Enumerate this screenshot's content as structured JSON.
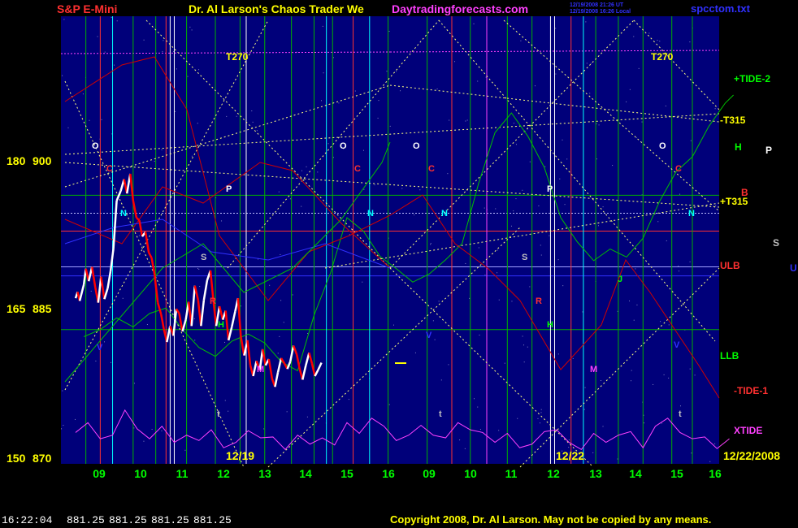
{
  "header": {
    "symbol": "S&P E-Mini",
    "title": "Dr. Al Larson's Chaos Trader We",
    "site": "Daytradingforecasts.com",
    "stamp1": "12/19/2008 21:26 UT",
    "stamp2": "12/19/2008 16:26 Local",
    "file": "spcctom.txt"
  },
  "footer": {
    "time": "16:22:04",
    "ohlc": [
      "881.25",
      "881.25",
      "881.25",
      "881.25"
    ],
    "copyright": "Copyright 2008, Dr. Al Larson. May not be copied by any means."
  },
  "colors": {
    "background": "#00007a",
    "price_up": "#ffffff",
    "price_down": "#ff0000",
    "tide": "#00c000",
    "xtide": "#ff40ff",
    "red_line": "#d00000",
    "blue_line": "#3030ff",
    "grid": "#00b000",
    "dotted": "#ffff80"
  },
  "chart_data": {
    "type": "line",
    "title": "S&P E-Mini",
    "left_axis_labels": [
      {
        "angle": "180",
        "price": "900"
      },
      {
        "angle": "165",
        "price": "885"
      },
      {
        "angle": "150",
        "price": "870"
      }
    ],
    "ylim": [
      870,
      920
    ],
    "x_ticks": [
      "09",
      "10",
      "11",
      "12",
      "13",
      "14",
      "15",
      "16",
      "09",
      "10",
      "11",
      "12",
      "13",
      "14",
      "15",
      "16"
    ],
    "date_labels": [
      "12/19",
      "12/22",
      "12/22/2008"
    ],
    "right_labels": [
      {
        "text": "+TIDE-2",
        "color": "#00ff00"
      },
      {
        "text": "-T315",
        "color": "#ffff00"
      },
      {
        "text": "H",
        "color": "#00ff00"
      },
      {
        "text": "P",
        "color": "#ffffff"
      },
      {
        "text": "B",
        "color": "#ff3030"
      },
      {
        "text": "+T315",
        "color": "#ffff00"
      },
      {
        "text": "S",
        "color": "#c0c0c0"
      },
      {
        "text": "U",
        "color": "#3030ff"
      },
      {
        "text": "ULB",
        "color": "#ff3030"
      },
      {
        "text": "LLB",
        "color": "#00ff00"
      },
      {
        "text": "-TIDE-1",
        "color": "#ff3030"
      },
      {
        "text": "XTIDE",
        "color": "#ff40ff"
      }
    ],
    "t270_labels": [
      "T270",
      "T270"
    ],
    "planet_letters": [
      {
        "text": "O",
        "color": "#ffffff"
      },
      {
        "text": "C",
        "color": "#ff3030"
      },
      {
        "text": "N",
        "color": "#00ffff"
      },
      {
        "text": "P",
        "color": "#ffffff"
      },
      {
        "text": "S",
        "color": "#c0c0c0"
      },
      {
        "text": "R",
        "color": "#ff3030"
      },
      {
        "text": "H",
        "color": "#00ff00"
      },
      {
        "text": "V",
        "color": "#3030ff"
      },
      {
        "text": "M",
        "color": "#ff40ff"
      },
      {
        "text": "t",
        "color": "#c0c0c0"
      },
      {
        "text": "O",
        "color": "#ffffff"
      },
      {
        "text": "C",
        "color": "#ff3030"
      },
      {
        "text": "N",
        "color": "#00ffff"
      },
      {
        "text": "O",
        "color": "#ffffff"
      },
      {
        "text": "C",
        "color": "#ff3030"
      },
      {
        "text": "N",
        "color": "#00ffff"
      },
      {
        "text": "V",
        "color": "#3030ff"
      },
      {
        "text": "t",
        "color": "#c0c0c0"
      },
      {
        "text": "P",
        "color": "#ffffff"
      },
      {
        "text": "S",
        "color": "#c0c0c0"
      },
      {
        "text": "R",
        "color": "#ff3030"
      },
      {
        "text": "H",
        "color": "#00ff00"
      },
      {
        "text": "J",
        "color": "#00ff00"
      },
      {
        "text": "M",
        "color": "#ff40ff"
      },
      {
        "text": "O",
        "color": "#ffffff"
      },
      {
        "text": "C",
        "color": "#ff3030"
      },
      {
        "text": "N",
        "color": "#00ffff"
      },
      {
        "text": "V",
        "color": "#3030ff"
      },
      {
        "text": "t",
        "color": "#c0c0c0"
      }
    ],
    "series": [
      {
        "name": "price",
        "x": [
          0.0,
          0.05,
          0.1,
          0.2,
          0.25,
          0.32,
          0.4,
          0.48,
          0.55,
          0.62,
          0.7,
          0.78,
          0.85,
          0.92,
          1.0,
          1.1,
          1.18,
          1.25,
          1.33,
          1.4,
          1.48,
          1.55,
          1.62,
          1.7,
          1.78,
          1.85,
          1.92,
          2.0,
          2.08,
          2.15,
          2.22,
          2.3,
          2.38,
          2.45,
          2.52,
          2.6,
          2.68,
          2.75,
          2.82,
          2.9,
          2.98,
          3.05,
          3.12,
          3.2,
          3.28,
          3.35,
          3.42,
          3.5,
          3.58,
          3.65,
          3.72,
          3.8,
          3.88,
          3.95,
          4.02,
          4.1,
          4.18,
          4.25,
          4.32,
          4.4,
          4.48,
          4.55,
          4.62,
          4.7,
          4.78,
          4.85,
          4.92,
          5.0,
          5.08,
          5.15,
          5.22,
          5.3,
          5.38,
          5.45,
          5.52,
          5.6,
          5.68,
          5.75,
          5.82,
          5.9,
          5.98
        ],
        "values": [
          888.5,
          889.2,
          888.2,
          890.0,
          891.8,
          890.4,
          892.0,
          889.7,
          888.0,
          890.9,
          888.4,
          889.6,
          891.5,
          894.0,
          899.4,
          900.5,
          901.8,
          900.2,
          902.4,
          899.4,
          897.5,
          897.2,
          895.4,
          895.9,
          893.6,
          893.0,
          891.2,
          888.0,
          886.7,
          885.0,
          883.6,
          885.4,
          884.3,
          887.3,
          886.8,
          884.8,
          886.1,
          888.1,
          885.4,
          889.9,
          888.3,
          885.4,
          888.3,
          890.5,
          891.6,
          888.3,
          885.4,
          887.6,
          886.1,
          887.1,
          883.8,
          885.3,
          887.0,
          888.5,
          884.2,
          882.1,
          883.8,
          881.0,
          879.8,
          881.5,
          880.5,
          882.8,
          881.0,
          881.7,
          879.5,
          878.6,
          880.2,
          881.8,
          881.2,
          880.6,
          881.4,
          883.2,
          882.2,
          880.6,
          879.4,
          881.0,
          882.4,
          881.2,
          879.8,
          880.5,
          881.3
        ]
      },
      {
        "name": "+TIDE-2",
        "x": [
          0.2,
          0.6,
          1.0,
          1.4,
          1.8,
          2.2,
          2.6,
          3.0,
          3.4,
          3.8,
          4.2,
          4.6,
          5.0,
          5.4,
          5.8,
          6.2,
          6.6,
          7.0,
          7.4,
          7.8,
          8.2,
          8.6,
          9.0,
          9.4,
          9.8,
          10.2,
          10.6,
          11.0,
          11.4,
          11.8,
          12.2,
          12.6,
          13.0,
          13.4,
          13.8,
          14.2,
          14.6,
          15.0,
          15.4,
          15.8,
          16.0
        ],
        "values": [
          884.2,
          885.0,
          886.3,
          885.3,
          886.8,
          887.4,
          885.0,
          883.0,
          882.0,
          883.7,
          884.5,
          883.5,
          881.4,
          880.4,
          886.6,
          891.3,
          897.5,
          896.0,
          893.2,
          891.8,
          890.3,
          891.2,
          892.8,
          894.6,
          901.3,
          907.0,
          909.2,
          906.6,
          903.1,
          897.5,
          894.8,
          892.7,
          894.0,
          893.1,
          895.2,
          899.3,
          902.6,
          904.3,
          907.7,
          910.3,
          911.2
        ]
      },
      {
        "name": "XTIDE",
        "x": [
          0.0,
          0.3,
          0.6,
          0.9,
          1.2,
          1.5,
          1.8,
          2.1,
          2.4,
          2.7,
          3.0,
          3.3,
          3.6,
          3.9,
          4.2,
          4.5,
          4.8,
          5.1,
          5.4,
          5.7,
          6.0,
          6.3,
          6.6,
          6.9,
          7.2,
          7.5,
          7.8,
          8.1,
          8.4,
          8.7,
          9.0,
          9.3,
          9.6,
          9.9,
          10.2,
          10.5,
          10.8,
          11.1,
          11.4,
          11.7,
          12.0,
          12.3,
          12.6,
          12.9,
          13.2,
          13.5,
          13.8,
          14.1,
          14.4,
          14.7,
          15.0,
          15.3,
          15.6,
          15.9
        ],
        "values": [
          873.5,
          874.6,
          872.8,
          873.2,
          876.0,
          873.9,
          872.8,
          874.2,
          872.4,
          873.2,
          872.6,
          873.8,
          871.8,
          872.4,
          873.7,
          872.9,
          873.0,
          871.6,
          873.2,
          872.2,
          872.9,
          872.1,
          874.6,
          873.4,
          875.1,
          874.2,
          872.6,
          873.2,
          874.3,
          873.2,
          872.9,
          874.6,
          873.8,
          873.5,
          872.4,
          873.4,
          871.8,
          872.2,
          873.6,
          873.8,
          872.4,
          871.6,
          873.4,
          872.4,
          873.2,
          873.6,
          871.8,
          874.2,
          875.1,
          873.5,
          872.8,
          873.0,
          871.7,
          872.8
        ]
      }
    ]
  }
}
